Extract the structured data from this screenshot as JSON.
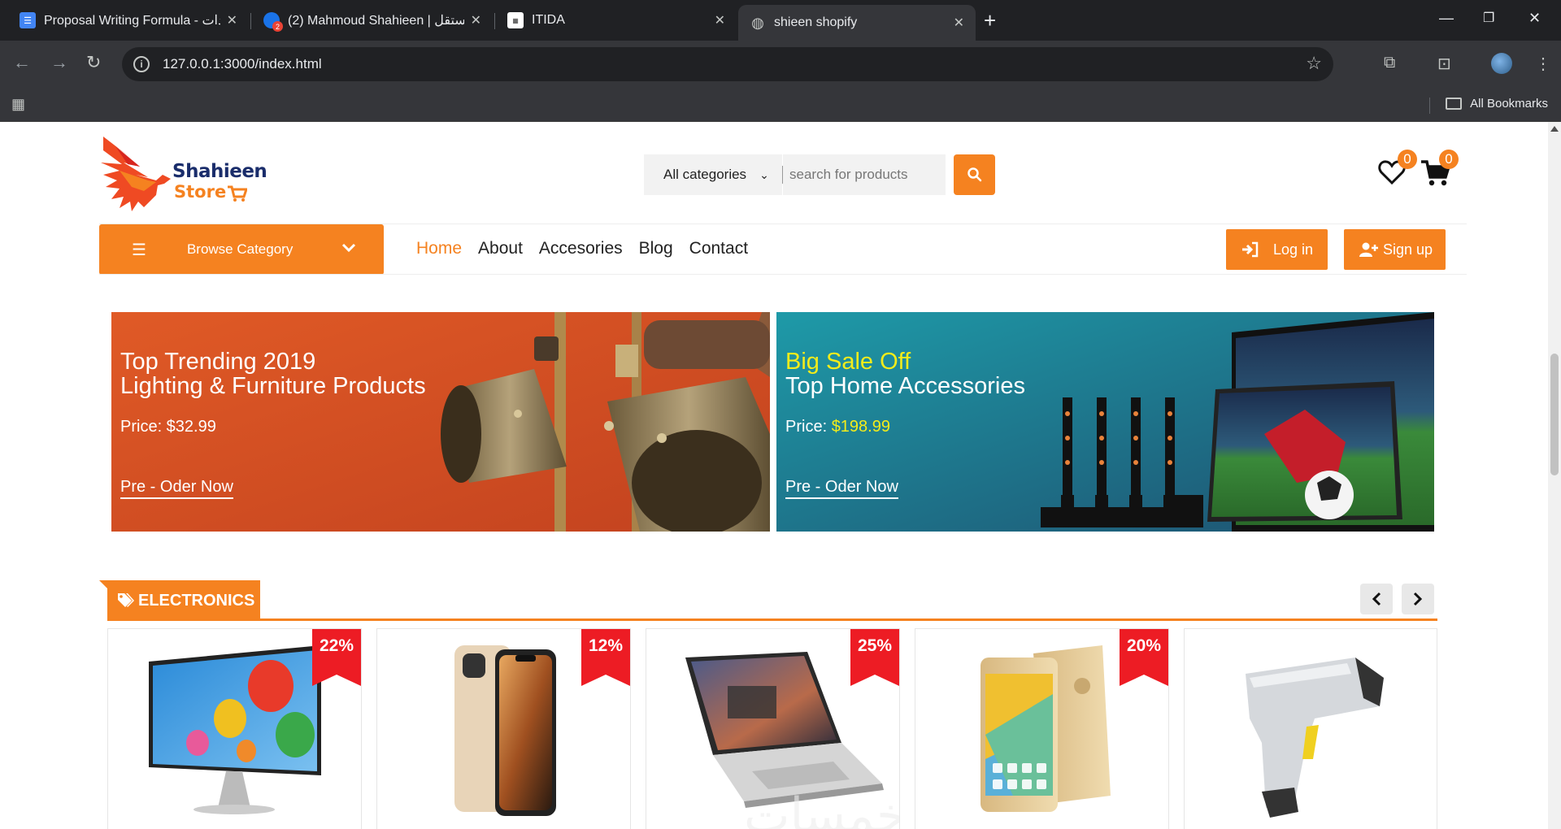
{
  "browser": {
    "tabs": [
      {
        "title": "Proposal Writing Formula - دات",
        "favicon_color": "#4285f4"
      },
      {
        "title": "(2) Mahmoud Shahieen | مستقل",
        "favicon_color": "#1a73e8",
        "badge": "2"
      },
      {
        "title": "ITIDA",
        "favicon_color": "#ffffff"
      },
      {
        "title": "shieen shopify",
        "active": true
      }
    ],
    "url": "127.0.0.1:3000/index.html",
    "bookmarks_label": "All Bookmarks"
  },
  "header": {
    "brand_name": "Shahieen",
    "brand_sub": "Store",
    "category_select": "All categories",
    "search_placeholder": "search for products",
    "wishlist_count": "0",
    "cart_count": "0"
  },
  "nav": {
    "browse_label": "Browse Category",
    "links": [
      "Home",
      "About",
      "Accesories",
      "Blog",
      "Contact"
    ],
    "login_label": "Log in",
    "signup_label": "Sign up"
  },
  "banners": [
    {
      "line1": "Top Trending 2019",
      "line2": "Lighting & Furniture Products",
      "price_label": "Price: $32.99",
      "cta": "Pre - Oder Now"
    },
    {
      "line1": "Big Sale Off",
      "line2": "Top Home Accessories",
      "price_prefix": "Price: ",
      "price_value": "$198.99",
      "cta": "Pre - Oder Now"
    }
  ],
  "section": {
    "title": "ELECTRONICS"
  },
  "products": [
    {
      "name": "Monitor",
      "discount": "22%"
    },
    {
      "name": "iPhone XS",
      "discount": "12%"
    },
    {
      "name": "MacBook",
      "discount": "25%"
    },
    {
      "name": "Android Phone",
      "discount": "20%"
    },
    {
      "name": "Barcode Scanner",
      "discount": ""
    }
  ],
  "colors": {
    "accent": "#f58220",
    "ribbon": "#ed1c24",
    "highlight": "#f3ec1b"
  }
}
